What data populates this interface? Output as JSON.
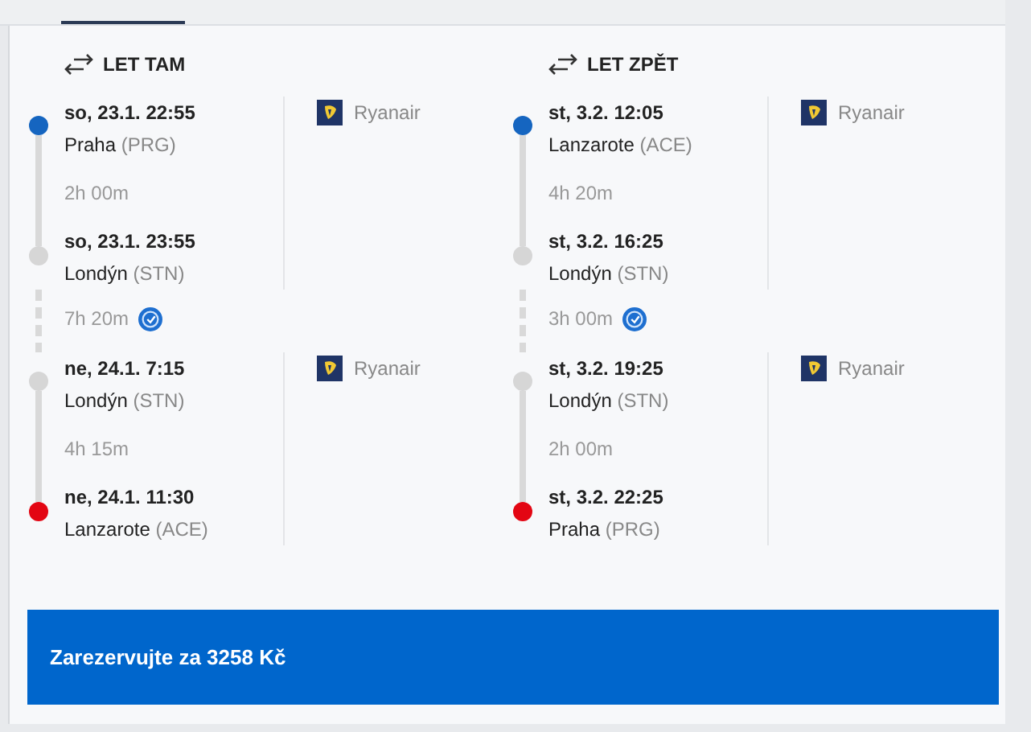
{
  "directions": [
    {
      "title": "LET TAM",
      "items": [
        {
          "kind": "segment",
          "departure": {
            "time": "so, 23.1. 22:55",
            "city": "Praha",
            "code": "(PRG)",
            "color": "#1565c0"
          },
          "duration": "2h 00m",
          "arrival": {
            "time": "so, 23.1. 23:55",
            "city": "Londýn",
            "code": "(STN)",
            "color": "#d6d6d6"
          },
          "carrier": "Ryanair"
        },
        {
          "kind": "layover",
          "duration": "7h 20m"
        },
        {
          "kind": "segment",
          "departure": {
            "time": "ne, 24.1. 7:15",
            "city": "Londýn",
            "code": "(STN)",
            "color": "#d6d6d6"
          },
          "duration": "4h 15m",
          "arrival": {
            "time": "ne, 24.1. 11:30",
            "city": "Lanzarote",
            "code": "(ACE)",
            "color": "#e30613"
          },
          "carrier": "Ryanair"
        }
      ]
    },
    {
      "title": "LET ZPĚT",
      "items": [
        {
          "kind": "segment",
          "departure": {
            "time": "st, 3.2. 12:05",
            "city": "Lanzarote",
            "code": "(ACE)",
            "color": "#1565c0"
          },
          "duration": "4h 20m",
          "arrival": {
            "time": "st, 3.2. 16:25",
            "city": "Londýn",
            "code": "(STN)",
            "color": "#d6d6d6"
          },
          "carrier": "Ryanair"
        },
        {
          "kind": "layover",
          "duration": "3h 00m"
        },
        {
          "kind": "segment",
          "departure": {
            "time": "st, 3.2. 19:25",
            "city": "Londýn",
            "code": "(STN)",
            "color": "#d6d6d6"
          },
          "duration": "2h 00m",
          "arrival": {
            "time": "st, 3.2. 22:25",
            "city": "Praha",
            "code": "(PRG)",
            "color": "#e30613"
          },
          "carrier": "Ryanair"
        }
      ]
    }
  ],
  "book_button": "Zarezervujte za 3258 Kč"
}
